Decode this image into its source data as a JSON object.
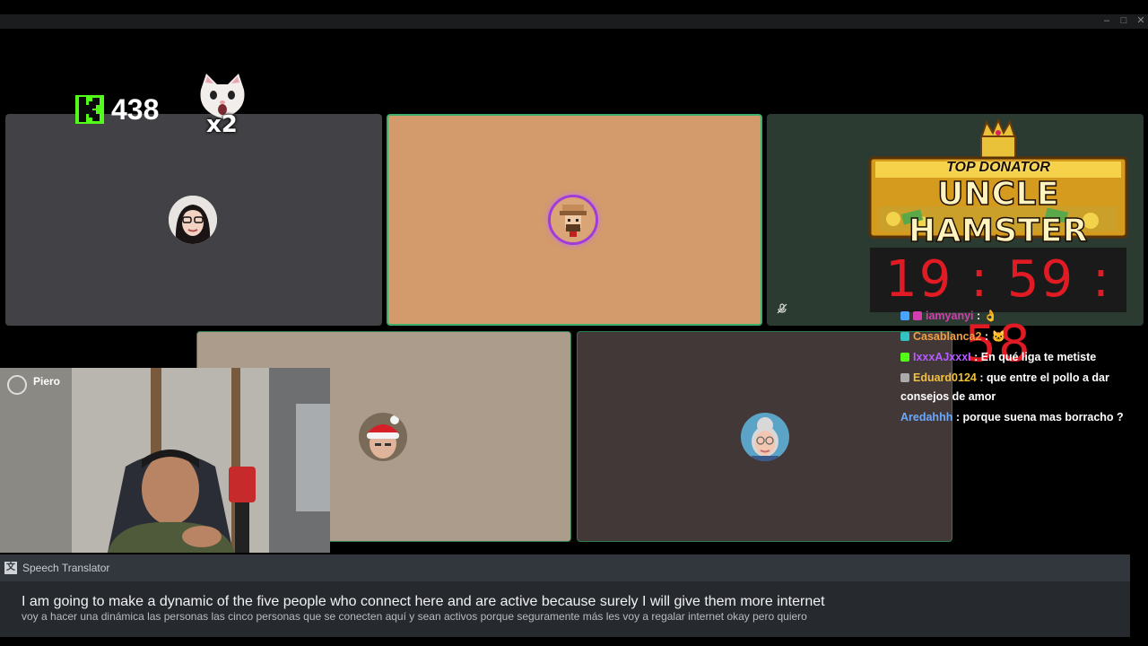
{
  "window": {
    "minimize": "–",
    "maximize": "□",
    "close": "✕"
  },
  "kick": {
    "count": "438"
  },
  "cat_emote": {
    "multiplier": "x2"
  },
  "banner": {
    "line1": "TOP DONATOR",
    "line2": "UNCLE HAMSTER"
  },
  "timer": {
    "value": "19 : 59 : 58"
  },
  "chat": {
    "messages": [
      {
        "user": "iamyanyi",
        "text": "👌",
        "user_color": "#d43fb0",
        "badge_color": "#4aa3ff"
      },
      {
        "user": "Casablanca2",
        "text": "🐱",
        "user_color": "#f0a040",
        "badge_color": "#34c3c3"
      },
      {
        "user": "IxxxAJxxxI",
        "text": "En qué liga te metiste",
        "user_color": "#b35cff",
        "badge_color": "#53fc18"
      },
      {
        "user": "Eduard0124",
        "text": "que entre el pollo a dar consejos de amor",
        "user_color": "#f0c040",
        "badge_color": "#aaaaaa"
      },
      {
        "user": "Aredahhh",
        "text": "porque suena mas borracho ?",
        "user_color": "#6aa8ff",
        "badge_color": ""
      }
    ]
  },
  "camera": {
    "name": "Piero"
  },
  "translator": {
    "title": "Speech Translator",
    "english": "I am going to make a dynamic of the five people who connect here and are active because surely I will give them more internet",
    "spanish": "voy a hacer una dinámica las personas las cinco personas que se conecten aquí y sean activos porque seguramente más les voy a regalar internet okay pero quiero"
  },
  "colors": {
    "accent_green": "#3fae6a",
    "tile_gray": "#424246",
    "tile_orange": "#d39a6c",
    "tile_teal": "#2b3b31",
    "tile_beige": "#ac9c8b",
    "tile_mauve": "#433838",
    "timer_red": "#e01b24"
  }
}
